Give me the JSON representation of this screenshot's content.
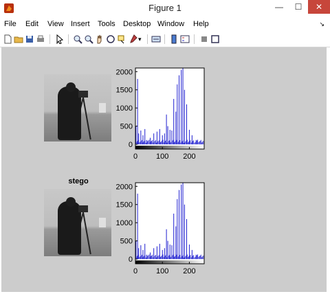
{
  "window": {
    "title": "Figure 1",
    "minimize": "—",
    "maximize": "☐",
    "close": "✕"
  },
  "menu": [
    "File",
    "Edit",
    "View",
    "Insert",
    "Tools",
    "Desktop",
    "Window",
    "Help"
  ],
  "menu_more": "↘",
  "toolbar": [
    "new-icon",
    "open-icon",
    "save-icon",
    "print-icon",
    "pointer-icon",
    "zoom-in-icon",
    "zoom-out-icon",
    "pan-icon",
    "rotate-icon",
    "data-cursor-icon",
    "brush-icon",
    "link-icon",
    "colorbar-icon",
    "legend-icon",
    "hide-icon",
    "show-icon"
  ],
  "figure": {
    "second_title": "stego",
    "chart_data": [
      {
        "type": "bar",
        "ylim": [
          -130,
          2100
        ],
        "xlim": [
          0,
          255
        ],
        "yticks": [
          "2000",
          "1500",
          "1000",
          "500",
          "0"
        ],
        "xticks": [
          "0",
          "100",
          "200"
        ],
        "peaks": [
          [
            2,
            500
          ],
          [
            8,
            1800
          ],
          [
            12,
            300
          ],
          [
            20,
            380
          ],
          [
            28,
            250
          ],
          [
            35,
            420
          ],
          [
            42,
            120
          ],
          [
            55,
            180
          ],
          [
            68,
            300
          ],
          [
            80,
            350
          ],
          [
            90,
            420
          ],
          [
            100,
            250
          ],
          [
            108,
            300
          ],
          [
            115,
            820
          ],
          [
            120,
            500
          ],
          [
            128,
            400
          ],
          [
            135,
            380
          ],
          [
            142,
            1250
          ],
          [
            150,
            900
          ],
          [
            155,
            1650
          ],
          [
            162,
            1900
          ],
          [
            170,
            2050
          ],
          [
            176,
            2100
          ],
          [
            182,
            1500
          ],
          [
            190,
            1100
          ],
          [
            200,
            400
          ],
          [
            210,
            250
          ],
          [
            225,
            120
          ],
          [
            240,
            80
          ]
        ]
      },
      {
        "type": "bar",
        "ylim": [
          -130,
          2100
        ],
        "xlim": [
          0,
          255
        ],
        "yticks": [
          "2000",
          "1500",
          "1000",
          "500",
          "0"
        ],
        "xticks": [
          "0",
          "100",
          "200"
        ],
        "peaks": [
          [
            2,
            500
          ],
          [
            8,
            1800
          ],
          [
            12,
            300
          ],
          [
            20,
            380
          ],
          [
            28,
            250
          ],
          [
            35,
            420
          ],
          [
            42,
            120
          ],
          [
            55,
            180
          ],
          [
            68,
            300
          ],
          [
            80,
            350
          ],
          [
            90,
            420
          ],
          [
            100,
            250
          ],
          [
            108,
            300
          ],
          [
            115,
            820
          ],
          [
            120,
            500
          ],
          [
            128,
            400
          ],
          [
            135,
            380
          ],
          [
            142,
            1250
          ],
          [
            150,
            900
          ],
          [
            155,
            1650
          ],
          [
            162,
            1900
          ],
          [
            170,
            2050
          ],
          [
            176,
            2100
          ],
          [
            182,
            1500
          ],
          [
            190,
            1100
          ],
          [
            200,
            400
          ],
          [
            210,
            250
          ],
          [
            225,
            120
          ],
          [
            240,
            80
          ]
        ]
      }
    ]
  },
  "colors": {
    "bar": "#1f1fd0",
    "canvas": "#cccccc",
    "close": "#c7463b"
  }
}
